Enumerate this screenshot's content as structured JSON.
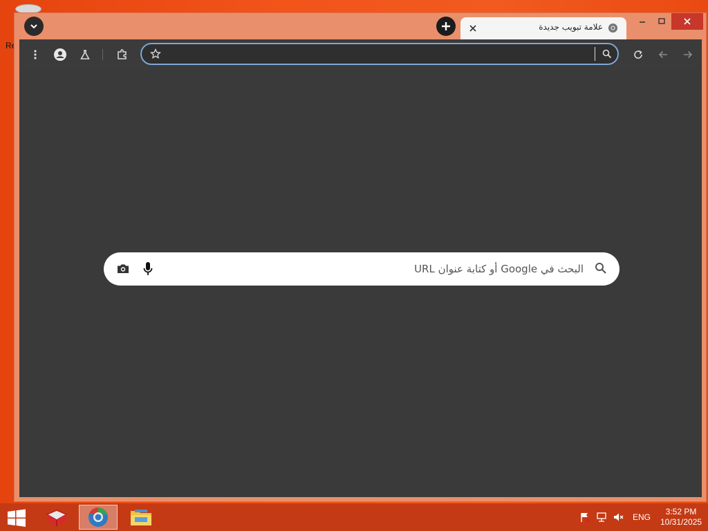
{
  "desktop": {
    "partial_label": "Re"
  },
  "browser": {
    "tab": {
      "title": "علامة تبويب جديدة",
      "favicon": "chrome-icon"
    },
    "toolbar": {
      "icons": [
        "menu-icon",
        "profile-icon",
        "labs-icon",
        "extensions-icon",
        "bookmark-star-icon",
        "reload-icon",
        "back-icon",
        "forward-icon"
      ]
    },
    "omnibox": {
      "value": ""
    },
    "ntp": {
      "search_placeholder": "البحث في Google أو كتابة عنوان URL"
    },
    "colors": {
      "frame": "#ea8f6b",
      "toolbar": "#3b3b3b",
      "content": "#3a3a3a",
      "omnibox_border": "#7fa6d6",
      "close_button": "#c7372a"
    }
  },
  "taskbar": {
    "apps": [
      "start-button",
      "app-icon",
      "browser-icon",
      "file-explorer-icon"
    ],
    "tray": {
      "language": "ENG",
      "time": "3:52 PM",
      "date": "10/31/2025"
    },
    "color": "#c43a14"
  }
}
